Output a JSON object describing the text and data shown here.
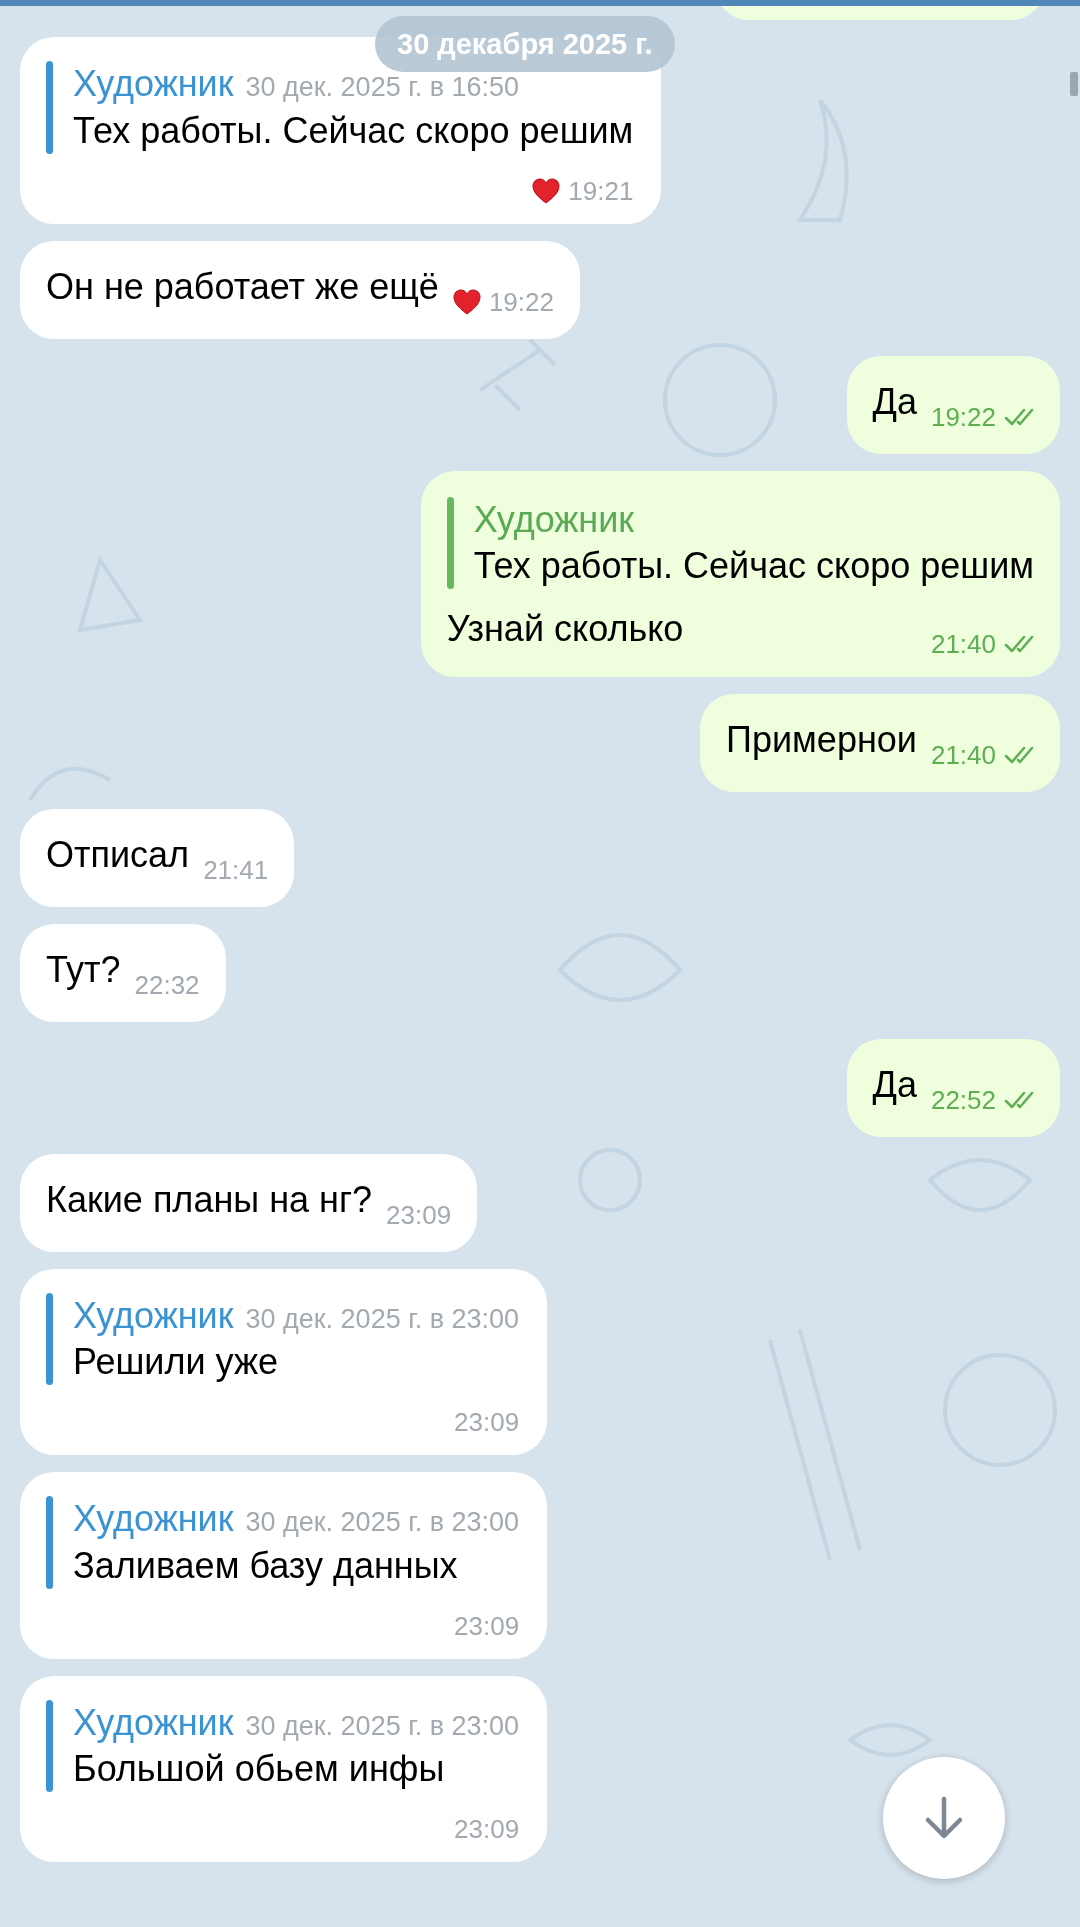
{
  "date_badge": "30 декабря 2025 г.",
  "messages": [
    {
      "kind": "partial",
      "outgoing": true
    },
    {
      "kind": "quote",
      "outgoing": false,
      "reply": {
        "name": "Художник",
        "date": "30 дек. 2025 г. в 16:50",
        "text": "Тех работы. Сейчас скоро решим"
      },
      "reaction": true,
      "time": "19:21"
    },
    {
      "kind": "text",
      "outgoing": false,
      "text": "Он не работает же ещё",
      "reaction": true,
      "time": "19:22"
    },
    {
      "kind": "text",
      "outgoing": true,
      "text": "Да",
      "time": "19:22",
      "read": true
    },
    {
      "kind": "reply",
      "outgoing": true,
      "reply": {
        "name": "Художник",
        "text": "Тех работы. Сейчас скоро решим"
      },
      "text": "Узнай сколько",
      "time": "21:40",
      "read": true
    },
    {
      "kind": "text",
      "outgoing": true,
      "text": "Примернои",
      "time": "21:40",
      "read": true
    },
    {
      "kind": "text",
      "outgoing": false,
      "text": "Отписал",
      "time": "21:41"
    },
    {
      "kind": "text",
      "outgoing": false,
      "text": "Тут?",
      "time": "22:32"
    },
    {
      "kind": "text",
      "outgoing": true,
      "text": "Да",
      "time": "22:52",
      "read": true
    },
    {
      "kind": "text",
      "outgoing": false,
      "text": "Какие планы на нг?",
      "time": "23:09"
    },
    {
      "kind": "quote",
      "outgoing": false,
      "reply": {
        "name": "Художник",
        "date": "30 дек. 2025 г. в 23:00",
        "text": "Решили уже"
      },
      "time": "23:09"
    },
    {
      "kind": "quote",
      "outgoing": false,
      "reply": {
        "name": "Художник",
        "date": "30 дек. 2025 г. в 23:00",
        "text": "Заливаем базу данных"
      },
      "time": "23:09"
    },
    {
      "kind": "quote",
      "outgoing": false,
      "reply": {
        "name": "Художник",
        "date": "30 дек. 2025 г. в 23:00",
        "text": "Большой обьем инфы"
      },
      "time": "23:09"
    }
  ]
}
